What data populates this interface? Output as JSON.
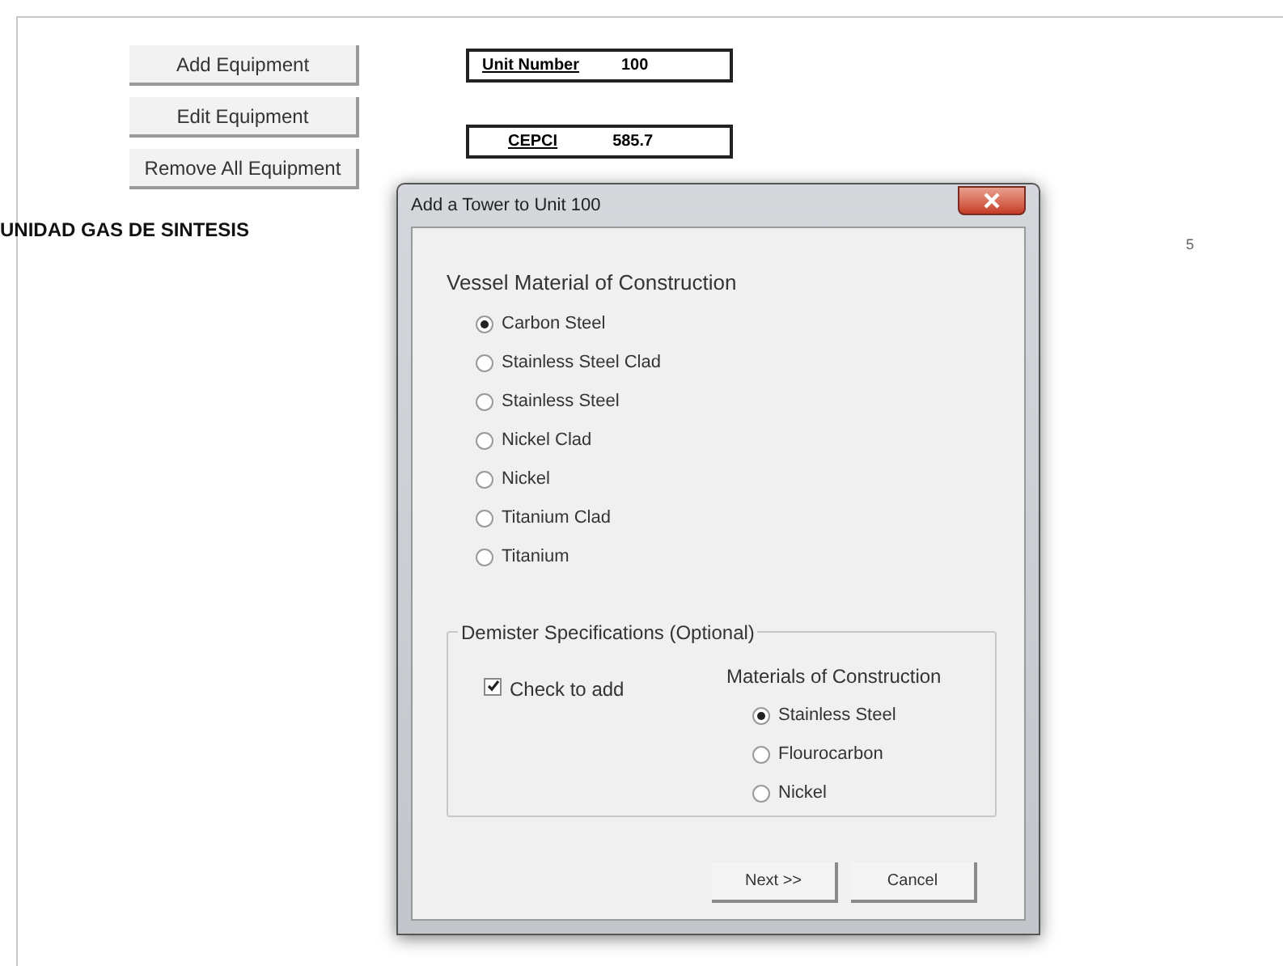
{
  "buttons": [
    {
      "label": "Add Equipment"
    },
    {
      "label": "Edit Equipment"
    },
    {
      "label": "Remove All Equipment"
    }
  ],
  "info_boxes": [
    {
      "label": "Unit Number",
      "value": "100"
    },
    {
      "label": "CEPCI",
      "value": "585.7"
    }
  ],
  "unit_title": "UNIDAD GAS DE SINTESIS",
  "background_text": "5",
  "dialog": {
    "title": "Add a Tower to Unit 100",
    "vessel_section": {
      "label": "Vessel Material of Construction",
      "options": [
        {
          "label": "Carbon Steel",
          "selected": true
        },
        {
          "label": "Stainless Steel Clad",
          "selected": false
        },
        {
          "label": "Stainless Steel",
          "selected": false
        },
        {
          "label": "Nickel Clad",
          "selected": false
        },
        {
          "label": "Nickel",
          "selected": false
        },
        {
          "label": "Titanium Clad",
          "selected": false
        },
        {
          "label": "Titanium",
          "selected": false
        }
      ]
    },
    "demister": {
      "legend": "Demister Specifications (Optional)",
      "checkbox": {
        "label": "Check to add",
        "checked": true
      },
      "materials_label": "Materials of Construction",
      "options": [
        {
          "label": "Stainless Steel",
          "selected": true
        },
        {
          "label": "Flourocarbon",
          "selected": false
        },
        {
          "label": "Nickel",
          "selected": false
        }
      ]
    },
    "buttons": [
      {
        "label": "Next >>"
      },
      {
        "label": "Cancel"
      }
    ]
  }
}
